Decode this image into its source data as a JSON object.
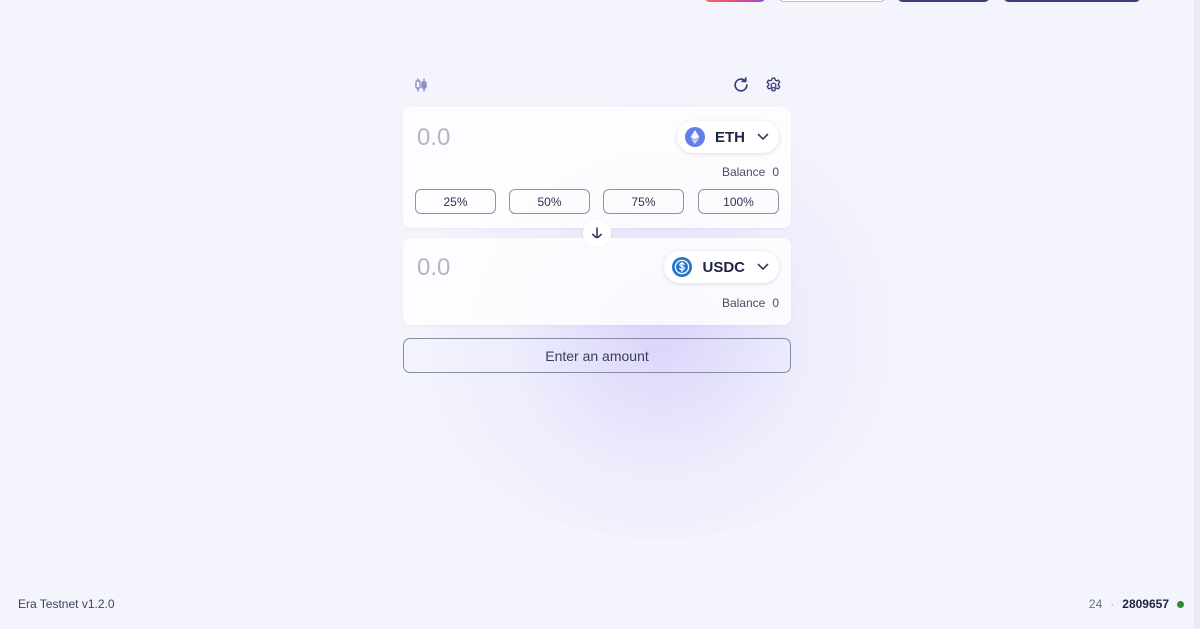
{
  "colors": {
    "accent": "#3a3e7c",
    "eth_icon": "#627eea",
    "usdc_icon": "#2775ca",
    "status_online": "#2f8a3e"
  },
  "toolbar": {
    "left_icon": "chart-candles-icon",
    "refresh_icon": "refresh-icon",
    "settings_icon": "gear-icon"
  },
  "from": {
    "placeholder": "0.0",
    "token": "ETH",
    "token_icon": "ethereum-icon",
    "balance_label": "Balance",
    "balance_value": "0",
    "percent_buttons": [
      "25%",
      "50%",
      "75%",
      "100%"
    ]
  },
  "swap_direction_icon": "arrow-down-icon",
  "to": {
    "placeholder": "0.0",
    "token": "USDC",
    "token_icon": "usdc-icon",
    "balance_label": "Balance",
    "balance_value": "0"
  },
  "submit": {
    "label": "Enter an amount"
  },
  "footer": {
    "network_version": "Era Testnet v1.2.0",
    "gas": "24",
    "separator": "·",
    "block_number": "2809657"
  }
}
